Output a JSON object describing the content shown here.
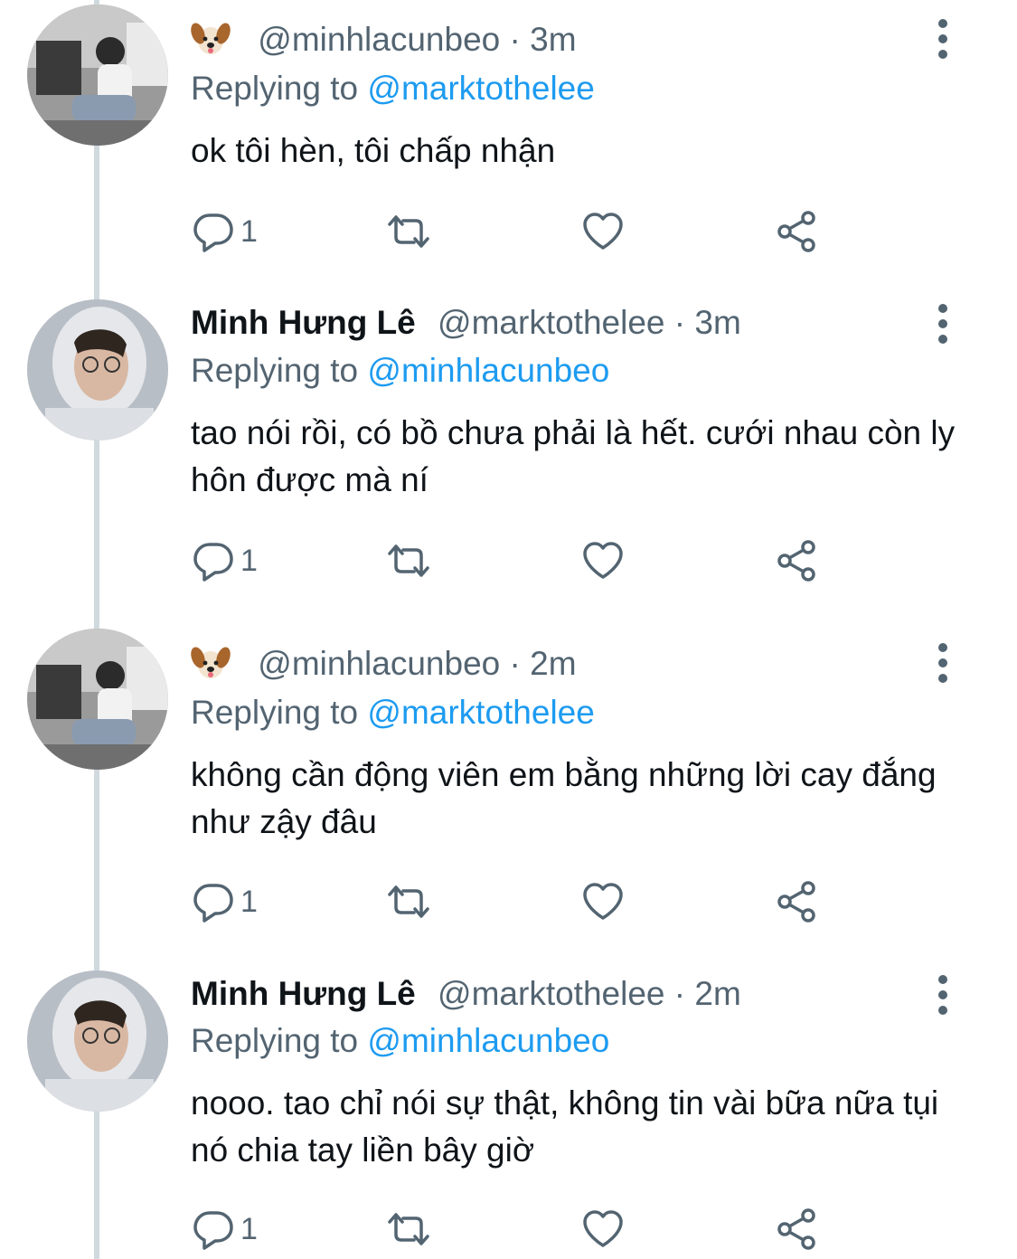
{
  "thread": {
    "tweets": [
      {
        "display_name": "",
        "emoji": "dog-face-emoji",
        "handle": "@minhlacunbeo",
        "time": "· 3m",
        "replying_prefix": "Replying to",
        "replying_to": "@marktothelee",
        "text": "ok tôi hèn, tôi chấp nhận",
        "reply_count": "1"
      },
      {
        "display_name": "Minh Hưng Lê",
        "handle": "@marktothelee",
        "time": "· 3m",
        "replying_prefix": "Replying to",
        "replying_to": "@minhlacunbeo",
        "text": "tao nói rồi, có bồ chưa phải là hết. cưới nhau còn ly hôn được mà ní",
        "reply_count": "1"
      },
      {
        "display_name": "",
        "emoji": "dog-face-emoji",
        "handle": "@minhlacunbeo",
        "time": "· 2m",
        "replying_prefix": "Replying to",
        "replying_to": "@marktothelee",
        "text": "không cần động viên em bằng những lời cay đắng như zậy đâu",
        "reply_count": "1"
      },
      {
        "display_name": "Minh Hưng Lê",
        "handle": "@marktothelee",
        "time": "· 2m",
        "replying_prefix": "Replying to",
        "replying_to": "@minhlacunbeo",
        "text": "nooo. tao chỉ nói sự thật, không tin vài bữa nữa tụi nó chia tay liền bây giờ",
        "reply_count": "1"
      }
    ]
  },
  "icons": {
    "reply": "reply-icon",
    "retweet": "retweet-icon",
    "like": "heart-icon",
    "share": "share-icon",
    "more": "more-options-icon"
  },
  "colors": {
    "text_primary": "#0f1419",
    "text_secondary": "#536471",
    "mention": "#1d9bf0",
    "thread_line": "#cfd9de",
    "icon": "#536471"
  }
}
